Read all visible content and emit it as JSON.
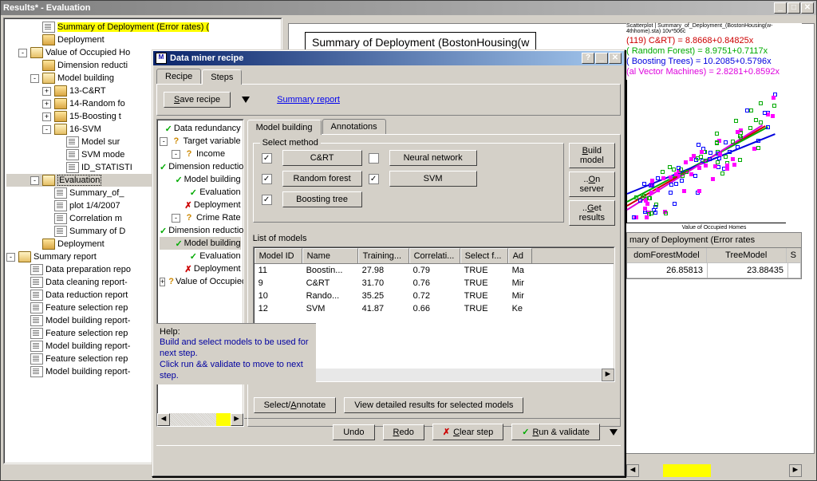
{
  "results_window": {
    "title": "Results* - Evaluation",
    "tree": [
      {
        "indent": 2,
        "icon": "doc",
        "label": "Summary of Deployment (Error rates) (",
        "highlight": true
      },
      {
        "indent": 2,
        "icon": "folder",
        "label": "Deployment"
      },
      {
        "indent": 1,
        "toggle": "-",
        "icon": "folder-open",
        "label": "Value of Occupied Ho"
      },
      {
        "indent": 2,
        "icon": "folder",
        "label": "Dimension reducti"
      },
      {
        "indent": 2,
        "toggle": "-",
        "icon": "folder-open",
        "label": "Model building"
      },
      {
        "indent": 3,
        "toggle": "+",
        "icon": "folder",
        "label": "13-C&RT"
      },
      {
        "indent": 3,
        "toggle": "+",
        "icon": "folder",
        "label": "14-Random fo"
      },
      {
        "indent": 3,
        "toggle": "+",
        "icon": "folder",
        "label": "15-Boosting t"
      },
      {
        "indent": 3,
        "toggle": "-",
        "icon": "folder-open",
        "label": "16-SVM"
      },
      {
        "indent": 4,
        "icon": "doc",
        "label": "Model sur"
      },
      {
        "indent": 4,
        "icon": "doc",
        "label": "SVM mode"
      },
      {
        "indent": 4,
        "icon": "doc",
        "label": "ID_STATISTI"
      },
      {
        "indent": 2,
        "toggle": "-",
        "icon": "folder-open",
        "label": "Evaluation",
        "selected": true
      },
      {
        "indent": 3,
        "icon": "doc",
        "label": "Summary_of_"
      },
      {
        "indent": 3,
        "icon": "chart",
        "label": "plot 1/4/2007"
      },
      {
        "indent": 3,
        "icon": "doc",
        "label": "Correlation m"
      },
      {
        "indent": 3,
        "icon": "doc",
        "label": "Summary of D"
      },
      {
        "indent": 2,
        "icon": "folder",
        "label": "Deployment"
      },
      {
        "indent": 0,
        "toggle": "-",
        "icon": "folder-open",
        "label": "Summary report"
      },
      {
        "indent": 1,
        "icon": "doc",
        "label": "Data preparation repo"
      },
      {
        "indent": 1,
        "icon": "doc",
        "label": "Data cleaning report-"
      },
      {
        "indent": 1,
        "icon": "doc",
        "label": "Data reduction report"
      },
      {
        "indent": 1,
        "icon": "doc",
        "label": "Feature selection rep"
      },
      {
        "indent": 1,
        "icon": "doc",
        "label": "Model building report-"
      },
      {
        "indent": 1,
        "icon": "doc",
        "label": "Feature selection rep"
      },
      {
        "indent": 1,
        "icon": "doc",
        "label": "Model building report-"
      },
      {
        "indent": 1,
        "icon": "doc",
        "label": "Feature selection rep"
      },
      {
        "indent": 1,
        "icon": "doc",
        "label": "Model building report-"
      }
    ]
  },
  "bg_document": {
    "title": "Summary of Deployment (BostonHousing(w",
    "chart_title": "Scatterplot | Summary_of_Deployment_(BostonHousing(w-4thhome).sta) 10v*506c",
    "legend_items": [
      "(119) C&RT) = 8.8668+0.84825x",
      "( Random Forest) = 8.9751+0.7117x",
      "( Boosting Trees) = 10.2085+0.5796x",
      "(al Vector Machines) = 2.8281+0.8592x"
    ],
    "xaxis_label": "Value of Occupied Homes",
    "table_title": "mary of Deployment (Error rates",
    "col1": "domForestModel",
    "col2": "TreeModel",
    "col3": "S",
    "val1": "26.85813",
    "val2": "23.88435"
  },
  "dialog": {
    "title": "Data miner recipe",
    "tabs": [
      "Recipe",
      "Steps"
    ],
    "active_tab": 1,
    "save_btn": "Save recipe",
    "summary_link": "Summary report",
    "recipe_tree": [
      {
        "indent": 0,
        "icon": "check",
        "label": "Data redundancy"
      },
      {
        "indent": 0,
        "toggle": "-",
        "icon": "q",
        "label": "Target variable"
      },
      {
        "indent": 1,
        "toggle": "-",
        "icon": "q",
        "label": "Income"
      },
      {
        "indent": 2,
        "icon": "check",
        "label": "Dimension reduction"
      },
      {
        "indent": 2,
        "icon": "check",
        "label": "Model building"
      },
      {
        "indent": 2,
        "icon": "check",
        "label": "Evaluation"
      },
      {
        "indent": 2,
        "icon": "x",
        "label": "Deployment"
      },
      {
        "indent": 1,
        "toggle": "-",
        "icon": "q",
        "label": "Crime  Rate"
      },
      {
        "indent": 2,
        "icon": "check",
        "label": "Dimension reduction"
      },
      {
        "indent": 2,
        "icon": "check",
        "label": "Model building",
        "selected": true
      },
      {
        "indent": 2,
        "icon": "check",
        "label": "Evaluation"
      },
      {
        "indent": 2,
        "icon": "x",
        "label": "Deployment"
      },
      {
        "indent": 1,
        "toggle": "+",
        "icon": "q",
        "label": "Value of Occupied Hom"
      }
    ],
    "subtabs": [
      "Model building",
      "Annotations"
    ],
    "active_subtab": 0,
    "groupbox_label": "Select method",
    "methods": {
      "cart": {
        "label": "C&RT",
        "checked": true
      },
      "nn": {
        "label": "Neural network",
        "checked": false
      },
      "rf": {
        "label": "Random forest",
        "checked": true
      },
      "svm": {
        "label": "SVM",
        "checked": true
      },
      "bt": {
        "label": "Boosting tree",
        "checked": true
      }
    },
    "side_buttons": {
      "build": "Build model",
      "server": "..On server",
      "results": "..Get results"
    },
    "list_label": "List of models",
    "list_cols": [
      "Model ID",
      "Name",
      "Training...",
      "Correlati...",
      "Select f...",
      "Ad"
    ],
    "list_rows": [
      [
        "11",
        "Boostin...",
        "27.98",
        "0.79",
        "TRUE",
        "Ma"
      ],
      [
        "9",
        "C&RT",
        "31.70",
        "0.76",
        "TRUE",
        "Mir"
      ],
      [
        "10",
        "Rando...",
        "35.25",
        "0.72",
        "TRUE",
        "Mir"
      ],
      [
        "12",
        "SVM",
        "41.87",
        "0.66",
        "TRUE",
        "Ke"
      ]
    ],
    "help_label": "Help:",
    "help_text": "Build and select models to be used for next step.\nClick run && validate to move to next step.",
    "btn_select": "Select/Annotate",
    "btn_detail": "View detailed results for selected models",
    "btn_undo": "Undo",
    "btn_redo": "Redo",
    "btn_clear": "Clear step",
    "btn_run": "Run & validate"
  }
}
